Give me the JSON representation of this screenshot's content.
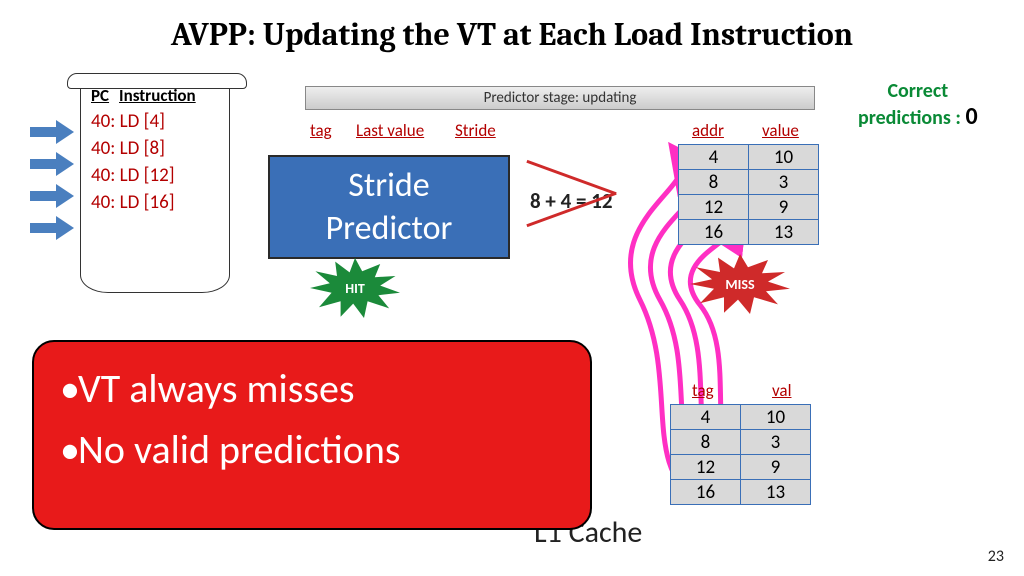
{
  "title": "AVPP: Updating the VT at Each Load Instruction",
  "scroll": {
    "pc_hdr": "PC",
    "instr_hdr": "Instruction",
    "rows": [
      "40: LD [4]",
      "40: LD [8]",
      "40: LD [12]",
      "40: LD [16]"
    ]
  },
  "stage": "Predictor stage: updating",
  "labels": {
    "tag": "tag",
    "last_value": "Last value",
    "stride": "Stride",
    "addr": "addr",
    "value": "value",
    "l1_tag": "tag",
    "l1_val": "val"
  },
  "stride_box": {
    "line1": "Stride",
    "line2": "Predictor"
  },
  "calc": "8 + 4 = 12",
  "vt": [
    {
      "addr": "4",
      "value": "10"
    },
    {
      "addr": "8",
      "value": "3"
    },
    {
      "addr": "12",
      "value": "9"
    },
    {
      "addr": "16",
      "value": "13"
    }
  ],
  "l1": [
    {
      "tag": "4",
      "val": "10"
    },
    {
      "tag": "8",
      "val": "3"
    },
    {
      "tag": "12",
      "val": "9"
    },
    {
      "tag": "16",
      "val": "13"
    }
  ],
  "hit": "HIT",
  "miss": "MISS",
  "correct": {
    "label1": "Correct",
    "label2": "predictions :",
    "n": "0"
  },
  "l1cache": "L1 Cache",
  "callout": {
    "b1": "VT always misses",
    "b2": "No valid predictions"
  },
  "page": "23"
}
